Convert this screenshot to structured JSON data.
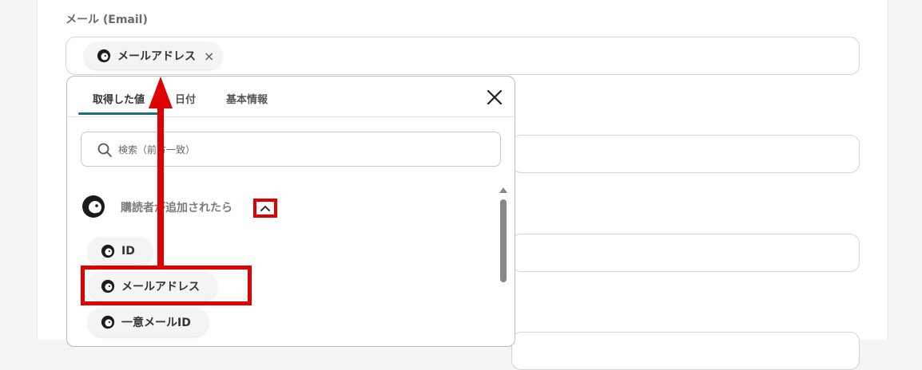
{
  "field": {
    "label": "メール (Email)"
  },
  "selected_chip": {
    "label": "メールアドレス",
    "remove_glyph": "×"
  },
  "dropdown": {
    "tabs": [
      {
        "label": "取得した値",
        "active": true
      },
      {
        "label": "日付",
        "active": false
      },
      {
        "label": "基本情報",
        "active": false
      }
    ],
    "close_icon": "close-icon",
    "search": {
      "placeholder": "検索（前方一致）",
      "value": ""
    },
    "group": {
      "label": "購読者が追加されたら",
      "expanded": true,
      "icon": "mailchimp-icon"
    },
    "items": [
      {
        "label": "ID"
      },
      {
        "label": "メールアドレス"
      },
      {
        "label": "一意メールID"
      }
    ]
  },
  "colors": {
    "annotation_red": "#e00000",
    "tab_accent": "#1f6f78"
  }
}
